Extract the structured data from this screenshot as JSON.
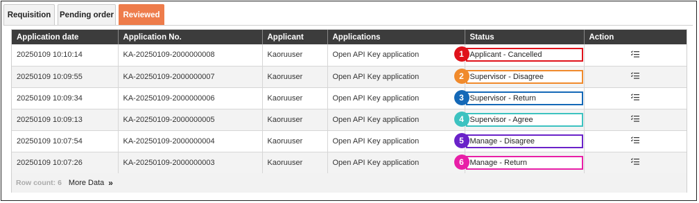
{
  "tabs": [
    {
      "label": "Requisition",
      "active": false
    },
    {
      "label": "Pending order",
      "active": false
    },
    {
      "label": "Reviewed",
      "active": true
    }
  ],
  "colors": {
    "active_tab": "#ee7c4b",
    "header_bg": "#3c3c3c"
  },
  "table": {
    "columns": [
      "Application date",
      "Application No.",
      "Applicant",
      "Applications",
      "Status",
      "Action"
    ],
    "rows": [
      {
        "date": "20250109 10:10:14",
        "no": "KA-20250109-2000000008",
        "applicant": "Kaoruuser",
        "application": "Open API Key application",
        "status": "Applicant - Cancelled",
        "marker": "1",
        "color": "#e0121b"
      },
      {
        "date": "20250109 10:09:55",
        "no": "KA-20250109-2000000007",
        "applicant": "Kaoruuser",
        "application": "Open API Key application",
        "status": "Supervisor - Disagree",
        "marker": "2",
        "color": "#f08a2c"
      },
      {
        "date": "20250109 10:09:34",
        "no": "KA-20250109-2000000006",
        "applicant": "Kaoruuser",
        "application": "Open API Key application",
        "status": "Supervisor - Return",
        "marker": "3",
        "color": "#1468b7"
      },
      {
        "date": "20250109 10:09:13",
        "no": "KA-20250109-2000000005",
        "applicant": "Kaoruuser",
        "application": "Open API Key application",
        "status": "Supervisor - Agree",
        "marker": "4",
        "color": "#3cc2c0"
      },
      {
        "date": "20250109 10:07:54",
        "no": "KA-20250109-2000000004",
        "applicant": "Kaoruuser",
        "application": "Open API Key application",
        "status": "Manage - Disagree",
        "marker": "5",
        "color": "#6a22c9"
      },
      {
        "date": "20250109 10:07:26",
        "no": "KA-20250109-2000000003",
        "applicant": "Kaoruuser",
        "application": "Open API Key application",
        "status": "Manage - Return",
        "marker": "6",
        "color": "#e81fa7"
      }
    ],
    "action_icon": "list-detail-icon"
  },
  "footer": {
    "row_count": "Row count: 6",
    "more_data": "More Data",
    "more_icon": "double-chevron-right-icon"
  }
}
